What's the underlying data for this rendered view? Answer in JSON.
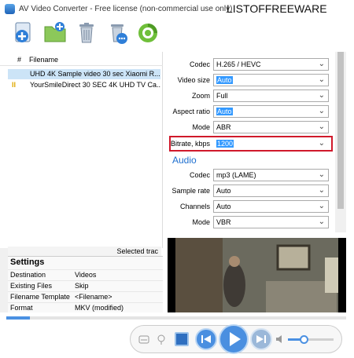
{
  "titlebar": {
    "title": "AV Video Converter - Free license (non-commercial use only)",
    "watermark": "LISTOFFREEWARE"
  },
  "toolbar": {
    "buttons": [
      "add-file-icon",
      "add-folder-icon",
      "delete-icon",
      "clear-list-icon",
      "convert-icon"
    ]
  },
  "filelist": {
    "col_num": "#",
    "col_filename": "Filename",
    "rows": [
      {
        "name": "UHD 4K Sample video 30 sec Xiaomi R..."
      },
      {
        "status": "II",
        "name": "YourSmileDirect 30 SEC 4K UHD TV Ca..."
      }
    ],
    "selected_label": "Selected trac"
  },
  "settings": {
    "title": "Settings",
    "rows": [
      {
        "key": "Destination",
        "value": "Videos"
      },
      {
        "key": "Existing Files",
        "value": "Skip"
      },
      {
        "key": "Filename Template",
        "value": "<Filename>"
      },
      {
        "key": "Format",
        "value": "MKV (modified)"
      }
    ]
  },
  "video_settings": {
    "codec": {
      "label": "Codec",
      "value": "H.265 / HEVC"
    },
    "video_size": {
      "label": "Video size",
      "value": "Auto"
    },
    "zoom": {
      "label": "Zoom",
      "value": "Full"
    },
    "aspect_ratio": {
      "label": "Aspect ratio",
      "value": "Auto"
    },
    "mode": {
      "label": "Mode",
      "value": "ABR"
    },
    "bitrate": {
      "label": "Bitrate, kbps",
      "value": "1200"
    }
  },
  "audio_settings": {
    "heading": "Audio",
    "codec": {
      "label": "Codec",
      "value": "mp3 (LAME)"
    },
    "sample_rate": {
      "label": "Sample rate",
      "value": "Auto"
    },
    "channels": {
      "label": "Channels",
      "value": "Auto"
    },
    "mode": {
      "label": "Mode",
      "value": "VBR"
    }
  },
  "colors": {
    "accent": "#1e6fcf",
    "highlight_border": "#d0192b",
    "selection": "#3399ff"
  },
  "player": {
    "seek_progress": 0.07,
    "volume": 0.35
  }
}
